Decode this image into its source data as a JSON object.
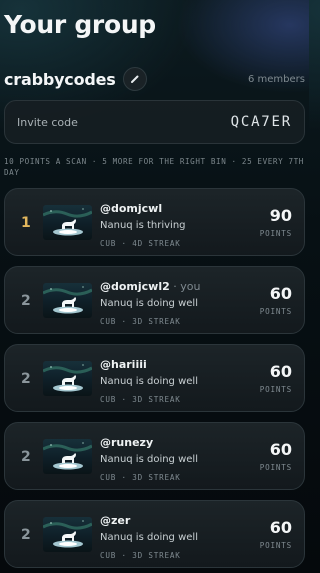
{
  "page": {
    "title": "Your group"
  },
  "group": {
    "name": "crabbycodes",
    "members": "6 members",
    "invite_label": "Invite code",
    "invite_code": "QCA7ER",
    "rules": "10 points a scan · 5 more for the right bin · 25 every 7th day"
  },
  "leaderboard": [
    {
      "rank": "1",
      "handle": "@domjcwl",
      "you": "",
      "status": "Nanuq is thriving",
      "meta": "CUB · 4D STREAK",
      "points": "90",
      "points_label": "POINTS"
    },
    {
      "rank": "2",
      "handle": "@domjcwl2",
      "you": " · you",
      "status": "Nanuq is doing well",
      "meta": "CUB · 3D STREAK",
      "points": "60",
      "points_label": "POINTS"
    },
    {
      "rank": "2",
      "handle": "@hariiii",
      "you": "",
      "status": "Nanuq is doing well",
      "meta": "CUB · 3D STREAK",
      "points": "60",
      "points_label": "POINTS"
    },
    {
      "rank": "2",
      "handle": "@runezy",
      "you": "",
      "status": "Nanuq is doing well",
      "meta": "CUB · 3D STREAK",
      "points": "60",
      "points_label": "POINTS"
    },
    {
      "rank": "2",
      "handle": "@zer",
      "you": "",
      "status": "Nanuq is doing well",
      "meta": "CUB · 3D STREAK",
      "points": "60",
      "points_label": "POINTS"
    }
  ],
  "icons": {
    "edit": "pencil-icon",
    "avatar": "polar-bear-scene"
  },
  "colors": {
    "rank_first": "#e2b75d",
    "rank_other": "#8b969c"
  }
}
